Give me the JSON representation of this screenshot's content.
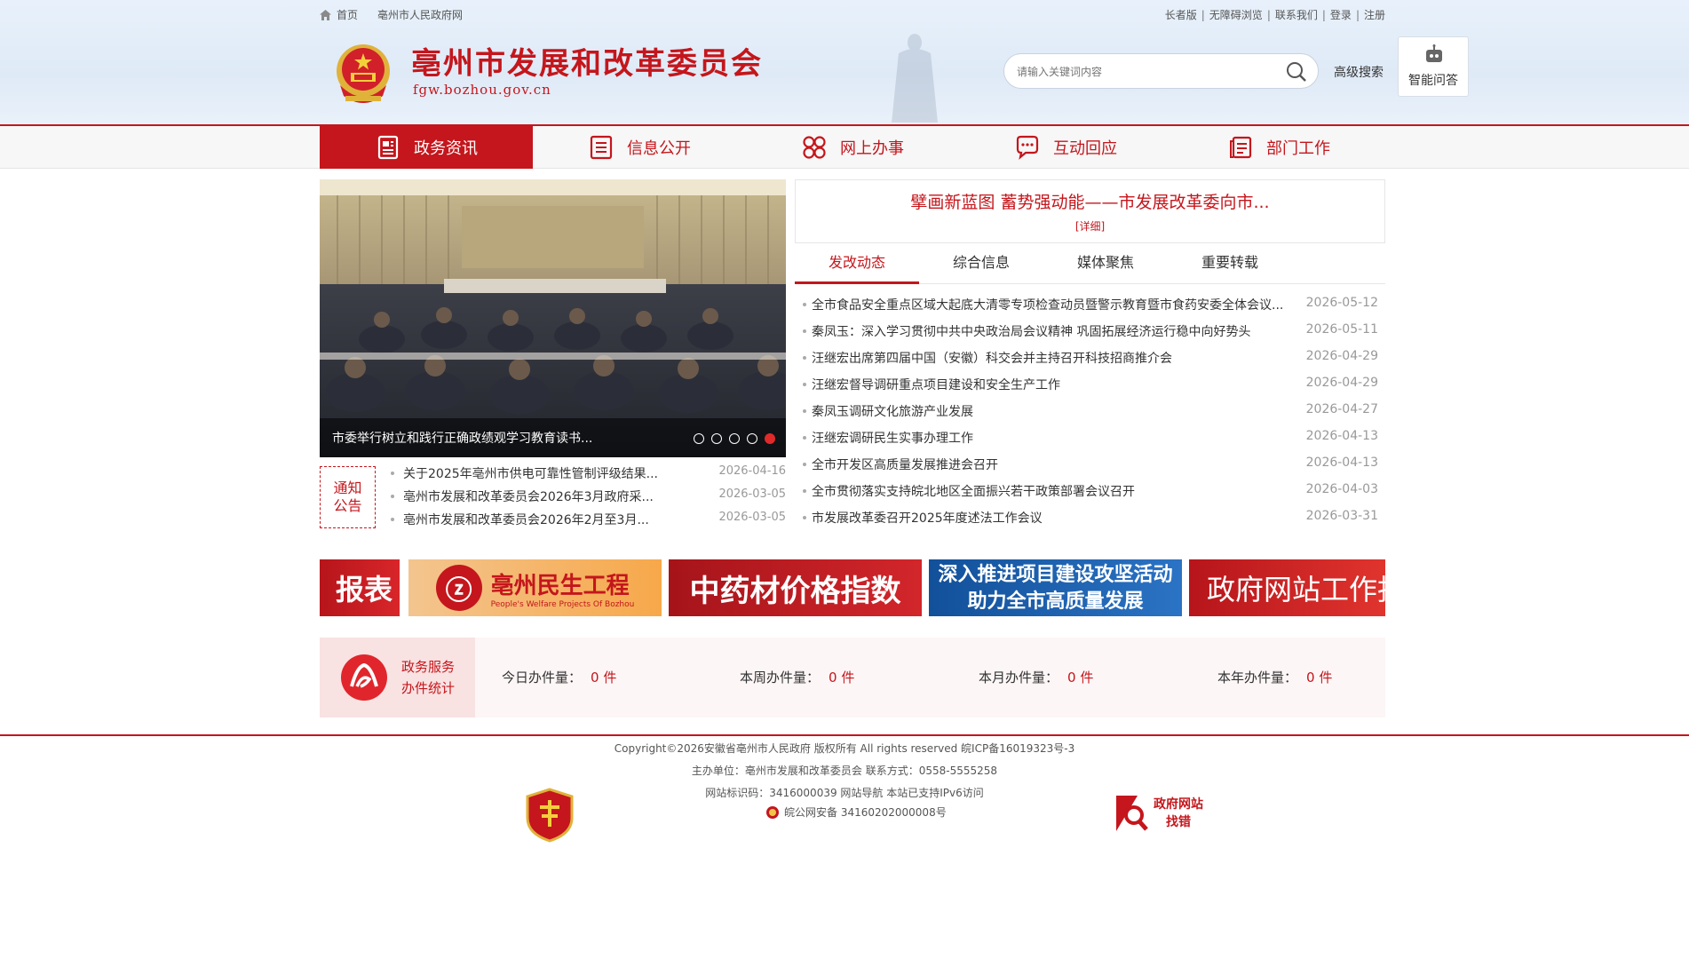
{
  "topbar": {
    "home": "首页",
    "gov_link": "亳州市人民政府网",
    "links": [
      "长者版",
      "无障碍浏览",
      "联系我们",
      "登录",
      "注册"
    ]
  },
  "header": {
    "title": "亳州市发展和改革委员会",
    "domain": "fgw.bozhou.gov.cn",
    "search_placeholder": "请输入关键词内容",
    "advanced_search": "高级搜索",
    "ai_qa": "智能问答"
  },
  "nav": [
    {
      "label": "政务资讯",
      "icon": "news-icon",
      "active": true
    },
    {
      "label": "信息公开",
      "icon": "list-icon",
      "active": false
    },
    {
      "label": "网上办事",
      "icon": "clover-icon",
      "active": false
    },
    {
      "label": "互动回应",
      "icon": "chat-icon",
      "active": false
    },
    {
      "label": "部门工作",
      "icon": "department-icon",
      "active": false
    }
  ],
  "slider": {
    "caption": "市委举行树立和践行正确政绩观学习教育读书...",
    "dots": 5,
    "active_dot": 5
  },
  "notice": {
    "badge": [
      "通知",
      "公告"
    ],
    "items": [
      {
        "title": "关于2025年亳州市供电可靠性管制评级结果...",
        "date": "2026-04-16"
      },
      {
        "title": "亳州市发展和改革委员会2026年3月政府采...",
        "date": "2026-03-05"
      },
      {
        "title": "亳州市发展和改革委员会2026年2月至3月...",
        "date": "2026-03-05"
      }
    ]
  },
  "headline": {
    "title": "擘画新蓝图 蓄势强动能——市发展改革委向市...",
    "more": "[详细]"
  },
  "tabs": [
    {
      "label": "发改动态",
      "active": true
    },
    {
      "label": "综合信息",
      "active": false
    },
    {
      "label": "媒体聚焦",
      "active": false
    },
    {
      "label": "重要转载",
      "active": false
    }
  ],
  "news": [
    {
      "title": "全市食品安全重点区域大起底大清零专项检查动员暨警示教育暨市食药安委全体会议...",
      "date": "2026-05-12"
    },
    {
      "title": "秦凤玉：深入学习贯彻中共中央政治局会议精神 巩固拓展经济运行稳中向好势头",
      "date": "2026-05-11"
    },
    {
      "title": "汪继宏出席第四届中国（安徽）科交会并主持召开科技招商推介会",
      "date": "2026-04-29"
    },
    {
      "title": "汪继宏督导调研重点项目建设和安全生产工作",
      "date": "2026-04-29"
    },
    {
      "title": "秦凤玉调研文化旅游产业发展",
      "date": "2026-04-27"
    },
    {
      "title": "汪继宏调研民生实事办理工作",
      "date": "2026-04-13"
    },
    {
      "title": "全市开发区高质量发展推进会召开",
      "date": "2026-04-13"
    },
    {
      "title": "全市贯彻落实支持皖北地区全面振兴若干政策部署会议召开",
      "date": "2026-04-03"
    },
    {
      "title": "市发展改革委召开2025年度述法工作会议",
      "date": "2026-03-31"
    }
  ],
  "banners": {
    "b0": "报表",
    "b1_title": "亳州民生工程",
    "b1_sub": "People's Welfare Projects Of Bozhou",
    "b2": "中药材价格指数",
    "b3_line1": "深入推进项目建设攻坚活动",
    "b3_line2": "助力全市高质量发展",
    "b4": "政府网站工作报"
  },
  "stats": {
    "title_line1": "政务服务",
    "title_line2": "办件统计",
    "items": [
      {
        "label": "今日办件量：",
        "value": "0 件"
      },
      {
        "label": "本周办件量：",
        "value": "0 件"
      },
      {
        "label": "本月办件量：",
        "value": "0 件"
      },
      {
        "label": "本年办件量：",
        "value": "0 件"
      }
    ]
  },
  "footer": {
    "copyright": "Copyright©2026安徽省亳州市人民政府 版权所有 All rights reserved 皖ICP备16019323号-3",
    "sponsor": "主办单位：亳州市发展和改革委员会 联系方式：0558-5555258",
    "site_id": "网站标识码：3416000039  网站导航  本站已支持IPv6访问",
    "police": "皖公网安备 34160202000008号",
    "error_line1": "政府网站",
    "error_line2": "找错"
  },
  "colors": {
    "brand_red": "#c4161c",
    "header_bg": "#e3edf8"
  }
}
